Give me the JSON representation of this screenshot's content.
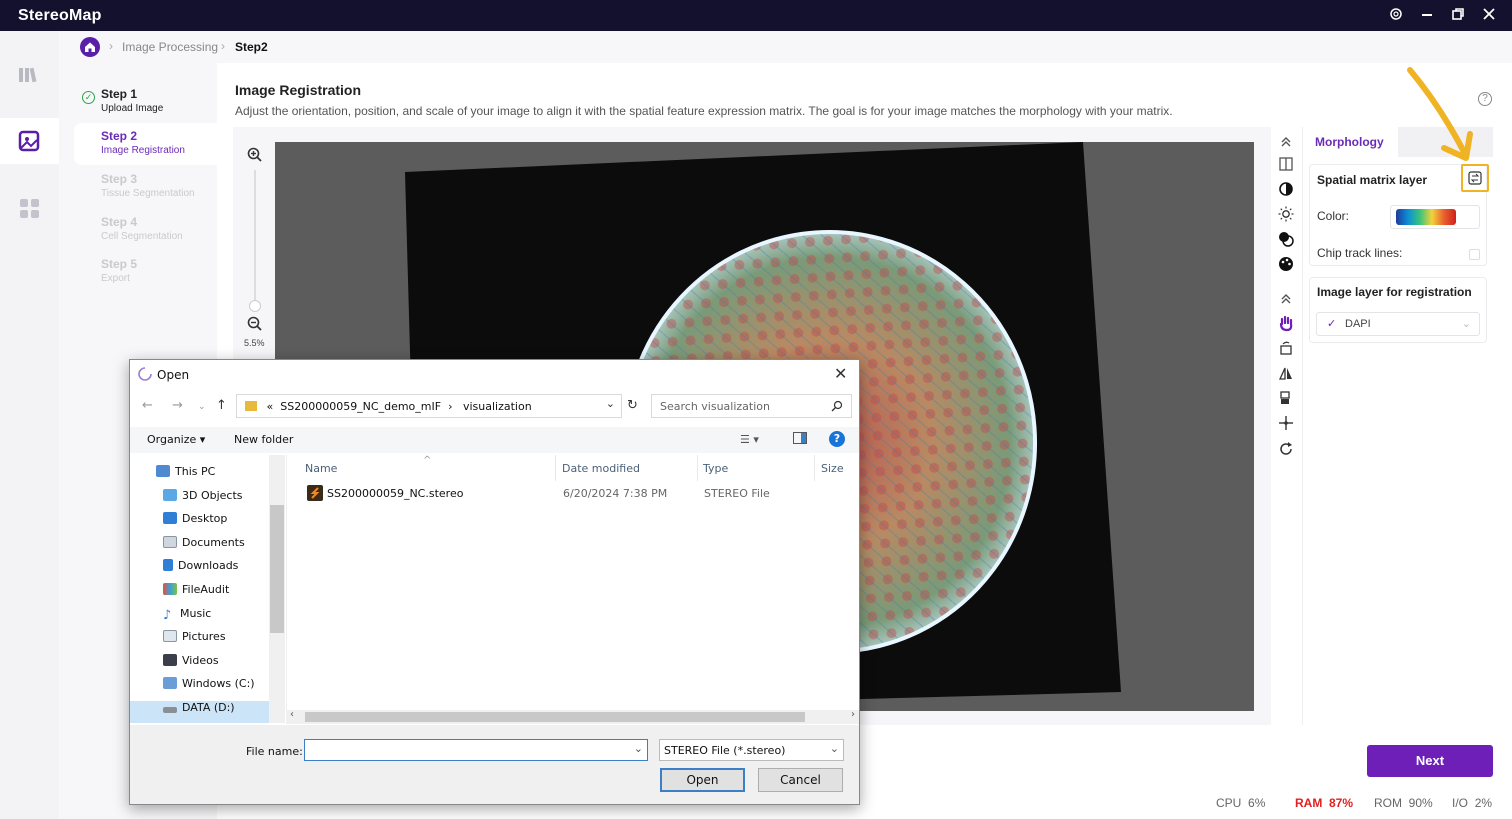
{
  "app": {
    "title": "StereoMap",
    "window_controls": [
      "settings-icon",
      "minimize-icon",
      "restore-icon",
      "close-icon"
    ]
  },
  "breadcrumb": [
    "Image Processing",
    "Step2"
  ],
  "steps": [
    {
      "title": "Step 1",
      "sub": "Upload Image",
      "state": "done"
    },
    {
      "title": "Step 2",
      "sub": "Image Registration",
      "state": "active"
    },
    {
      "title": "Step 3",
      "sub": "Tissue Segmentation",
      "state": "pending"
    },
    {
      "title": "Step 4",
      "sub": "Cell Segmentation",
      "state": "pending"
    },
    {
      "title": "Step 5",
      "sub": "Export",
      "state": "pending"
    }
  ],
  "main": {
    "title": "Image Registration",
    "description": "Adjust the orientation, position, and scale of your image to align it with the spatial feature expression matrix. The goal is for your image matches the morphology with your matrix.",
    "zoom_level": "5.5%"
  },
  "right_panel": {
    "tab": "Morphology",
    "spatial_title": "Spatial matrix layer",
    "color_label": "Color:",
    "chip_label": "Chip track lines:",
    "image_layer_title": "Image layer for registration",
    "image_layer_value": "DAPI"
  },
  "next_label": "Next",
  "status": {
    "cpu_label": "CPU",
    "cpu": "6%",
    "ram_label": "RAM",
    "ram": "87%",
    "rom_label": "ROM",
    "rom": "90%",
    "io_label": "I/O",
    "io": "2%"
  },
  "dialog": {
    "title": "Open",
    "path_prefix": "«",
    "path": [
      "SS200000059_NC_demo_mIF",
      "visualization"
    ],
    "search_placeholder": "Search visualization",
    "organize": "Organize",
    "new_folder": "New folder",
    "nav": [
      "This PC",
      "3D Objects",
      "Desktop",
      "Documents",
      "Downloads",
      "FileAudit",
      "Music",
      "Pictures",
      "Videos",
      "Windows (C:)",
      "DATA (D:)"
    ],
    "columns": [
      "Name",
      "Date modified",
      "Type",
      "Size"
    ],
    "files": [
      {
        "name": "SS200000059_NC.stereo",
        "modified": "6/20/2024 7:38 PM",
        "type": "STEREO File",
        "size": ""
      }
    ],
    "file_name_label": "File name:",
    "file_name_value": "",
    "file_type": "STEREO File (*.stereo)",
    "open_label": "Open",
    "cancel_label": "Cancel"
  },
  "colors": {
    "accent": "#6d1fb8",
    "highlight": "#f0b323",
    "titlebar": "#14112e",
    "ram_alert": "#e02020"
  }
}
